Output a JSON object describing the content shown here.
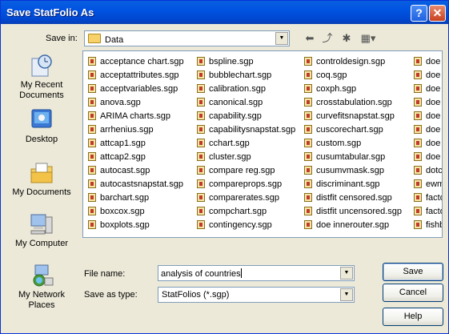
{
  "window": {
    "title": "Save StatFolio As",
    "help_glyph": "?",
    "close_glyph": "✕"
  },
  "save_in": {
    "label": "Save in:",
    "value": "Data"
  },
  "toolbar": {
    "back_glyph": "⬅",
    "up_glyph": "⤴",
    "new_folder_glyph": "✱",
    "views_glyph": "▦▾"
  },
  "places": [
    {
      "label": "My Recent Documents",
      "icon": "recent-documents-icon"
    },
    {
      "label": "Desktop",
      "icon": "desktop-icon"
    },
    {
      "label": "My Documents",
      "icon": "my-documents-icon"
    },
    {
      "label": "My Computer",
      "icon": "my-computer-icon"
    },
    {
      "label": "My Network Places",
      "icon": "network-places-icon"
    }
  ],
  "files": [
    [
      "acceptance chart.sgp",
      "acceptattributes.sgp",
      "acceptvariables.sgp",
      "anova.sgp",
      "ARIMA charts.sgp",
      "arrhenius.sgp",
      "attcap1.sgp",
      "attcap2.sgp",
      "autocast.sgp",
      "autocastsnapstat.sgp",
      "barchart.sgp",
      "boxcox.sgp",
      "boxplots.sgp"
    ],
    [
      "bspline.sgp",
      "bubblechart.sgp",
      "calibration.sgp",
      "canonical.sgp",
      "capability.sgp",
      "capabilitysnapstat.sgp",
      "cchart.sgp",
      "cluster.sgp",
      "compare reg.sgp",
      "compareprops.sgp",
      "comparerates.sgp",
      "compchart.sgp",
      "contingency.sgp"
    ],
    [
      "controldesign.sgp",
      "coq.sgp",
      "coxph.sgp",
      "crosstabulation.sgp",
      "curvefitsnapstat.sgp",
      "cuscorechart.sgp",
      "custom.sgp",
      "cusumtabular.sgp",
      "cusumvmask.sgp",
      "discriminant.sgp",
      "distfit censored.sgp",
      "distfit uncensored.sgp",
      "doe innerouter.sgp"
    ],
    [
      "doe",
      "doe",
      "doe",
      "doe",
      "doe",
      "doe",
      "doe",
      "doe",
      "dotc",
      "ewm",
      "facto",
      "facto",
      "fishb"
    ]
  ],
  "file_name": {
    "label": "File name:",
    "value": "analysis of countries"
  },
  "save_as_type": {
    "label": "Save as type:",
    "value": "StatFolios (*.sgp)"
  },
  "buttons": {
    "save": "Save",
    "cancel": "Cancel",
    "help": "Help"
  },
  "combo_arrow": "▼"
}
